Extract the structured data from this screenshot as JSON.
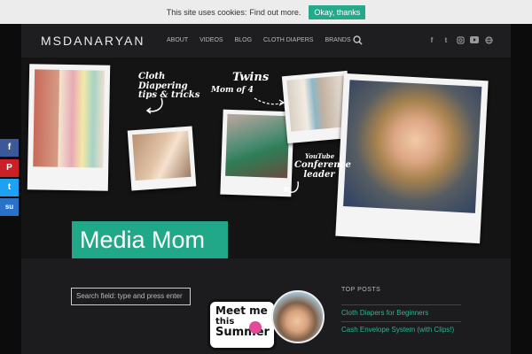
{
  "cookie": {
    "message": "This site uses cookies:",
    "link": "Find out more.",
    "button": "Okay, thanks"
  },
  "header": {
    "logo": "MSDANARYAN",
    "nav": [
      "ABOUT",
      "VIDEOS",
      "BLOG",
      "CLOTH DIAPERS",
      "BRANDS"
    ]
  },
  "social": [
    "f",
    "t",
    "ig",
    "yt",
    "web"
  ],
  "hero": {
    "caption_cloth": "Cloth Diapering tips & tricks",
    "caption_twins": "Twins",
    "caption_mom": "Mom of 4",
    "caption_youtube": "YouTube",
    "caption_conference": "Conference leader",
    "headline": "Media Mom"
  },
  "search": {
    "placeholder": "Search field: type and press enter"
  },
  "promo": {
    "line1": "Meet me",
    "line2": "this",
    "line3": "Summer"
  },
  "top_posts": {
    "title": "TOP POSTS",
    "items": [
      "Cloth Diapers for Beginners",
      "Cash Envelope System (with Clips!)"
    ]
  },
  "share": [
    "f",
    "P",
    "t",
    "su"
  ],
  "colors": {
    "accent": "#20a889",
    "facebook": "#3b5998",
    "pinterest": "#cb2027",
    "twitter": "#1da1f2",
    "stumble": "#2a72c9"
  }
}
